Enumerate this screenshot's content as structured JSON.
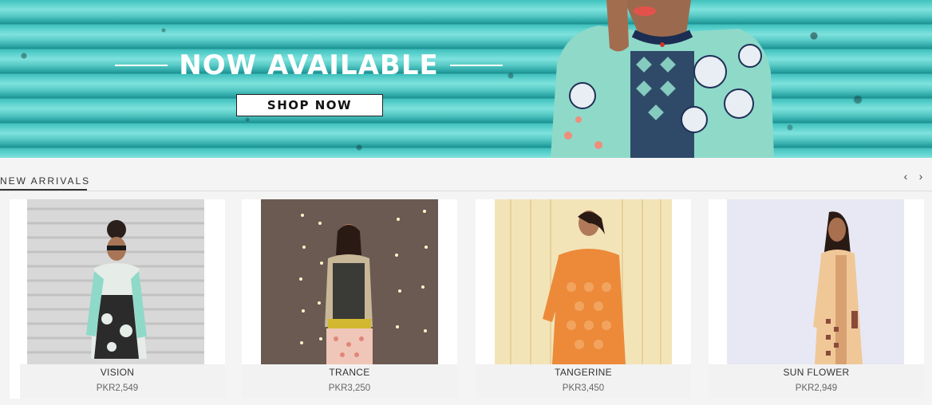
{
  "banner": {
    "headline": "NOW AVAILABLE",
    "cta_label": "SHOP NOW"
  },
  "new_arrivals": {
    "title": "NEW ARRIVALS",
    "prev_icon": "chevron-left-icon",
    "next_icon": "chevron-right-icon",
    "products": [
      {
        "name": "VISION",
        "price": "PKR2,549"
      },
      {
        "name": "TRANCE",
        "price": "PKR3,250"
      },
      {
        "name": "TANGERINE",
        "price": "PKR3,450"
      },
      {
        "name": "SUN FLOWER",
        "price": "PKR2,949"
      }
    ]
  },
  "colors": {
    "banner_teal": "#3fc0bd",
    "text_dark": "#333333",
    "price_grey": "#666666"
  }
}
